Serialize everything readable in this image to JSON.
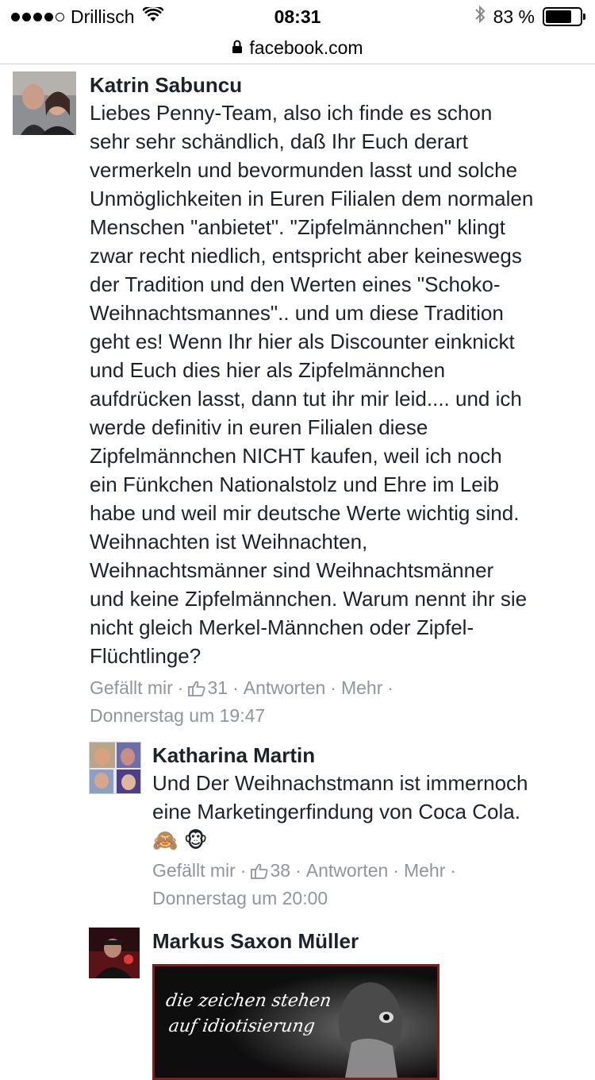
{
  "status_bar": {
    "carrier": "Drillisch",
    "time": "08:31",
    "battery_percent": "83 %",
    "battery_level": 0.83,
    "signal_dots_filled": 4,
    "signal_dots_total": 5
  },
  "address_bar": {
    "url": "facebook.com"
  },
  "comments": [
    {
      "author": "Katrin Sabuncu",
      "text": "Liebes Penny-Team, also ich finde es schon\nsehr sehr schändlich, daß Ihr Euch derart\nvermerkeln und bevormunden lasst und solche\nUnmöglichkeiten in Euren Filialen dem normalen\nMenschen \"anbietet\". \"Zipfelmännchen\" klingt\nzwar recht niedlich, entspricht aber keineswegs\nder Tradition und den Werten eines \"Schoko-\nWeihnachtsmannes\".. und um diese Tradition\ngeht es! Wenn Ihr hier als Discounter einknickt\nund Euch dies hier als Zipfelmännchen\naufdrücken lasst, dann tut ihr mir leid.... und ich\nwerde definitiv in euren Filialen diese\nZipfelmännchen NICHT kaufen, weil ich noch\nein Fünkchen Nationalstolz und Ehre im Leib\nhabe und weil mir deutsche Werte wichtig sind.\nWeihnachten ist Weihnachten,\nWeihnachtsmänner sind Weihnachtsmänner\nund keine Zipfelmännchen. Warum nennt ihr sie\nnicht gleich Merkel-Männchen oder Zipfel-\nFlüchtlinge?",
      "like_label": "Gefällt mir",
      "like_count": "31",
      "reply_label": "Antworten",
      "more_label": "Mehr",
      "timestamp": "Donnerstag um 19:47"
    },
    {
      "author": "Katharina Martin",
      "text": "Und Der Weihnachstmann ist immernoch\neine Marketingerfindung von Coca Cola.\n🙈 🐵",
      "like_label": "Gefällt mir",
      "like_count": "38",
      "reply_label": "Antworten",
      "more_label": "Mehr",
      "timestamp": "Donnerstag um 20:00"
    },
    {
      "author": "Markus Saxon Müller",
      "attachment_text_line1": "die zeichen stehen",
      "attachment_text_line2": "auf idiotisierung"
    }
  ],
  "colors": {
    "text": "#1d2129",
    "meta": "#90949c",
    "attachment_border": "#7a2021"
  },
  "icons": [
    "wifi-icon",
    "bluetooth-icon",
    "battery-icon",
    "lock-icon",
    "thumbs-up-icon"
  ]
}
